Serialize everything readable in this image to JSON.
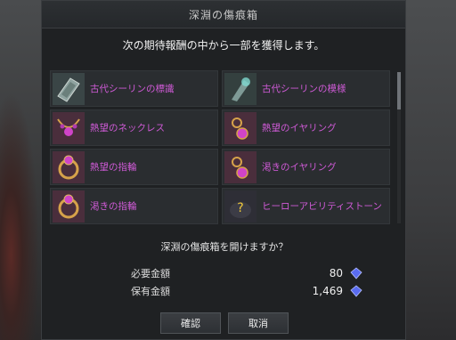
{
  "dialog": {
    "title": "深淵の傷痕箱",
    "prompt": "次の期待報酬の中から一部を獲得します。",
    "rewards": [
      {
        "name": "古代シーリンの標識",
        "icon": "ancient-sign-icon"
      },
      {
        "name": "古代シーリンの模様",
        "icon": "ancient-pattern-icon"
      },
      {
        "name": "熱望のネックレス",
        "icon": "necklace-icon"
      },
      {
        "name": "熱望のイヤリング",
        "icon": "earring-icon"
      },
      {
        "name": "熱望の指輪",
        "icon": "ring-icon"
      },
      {
        "name": "渇きのイヤリング",
        "icon": "earring-icon"
      },
      {
        "name": "渇きの指輪",
        "icon": "ring-icon"
      },
      {
        "name": "ヒーローアビリティストーン",
        "icon": "ability-stone-icon"
      }
    ],
    "question": "深淵の傷痕箱を開けますか？",
    "required_label": "必要金額",
    "required_value": "80",
    "owned_label": "保有金額",
    "owned_value": "1,469",
    "currency_icon": "blue-crystal-icon",
    "confirm_label": "確認",
    "cancel_label": "取消",
    "reward_name_color": "#cf5ad6"
  }
}
